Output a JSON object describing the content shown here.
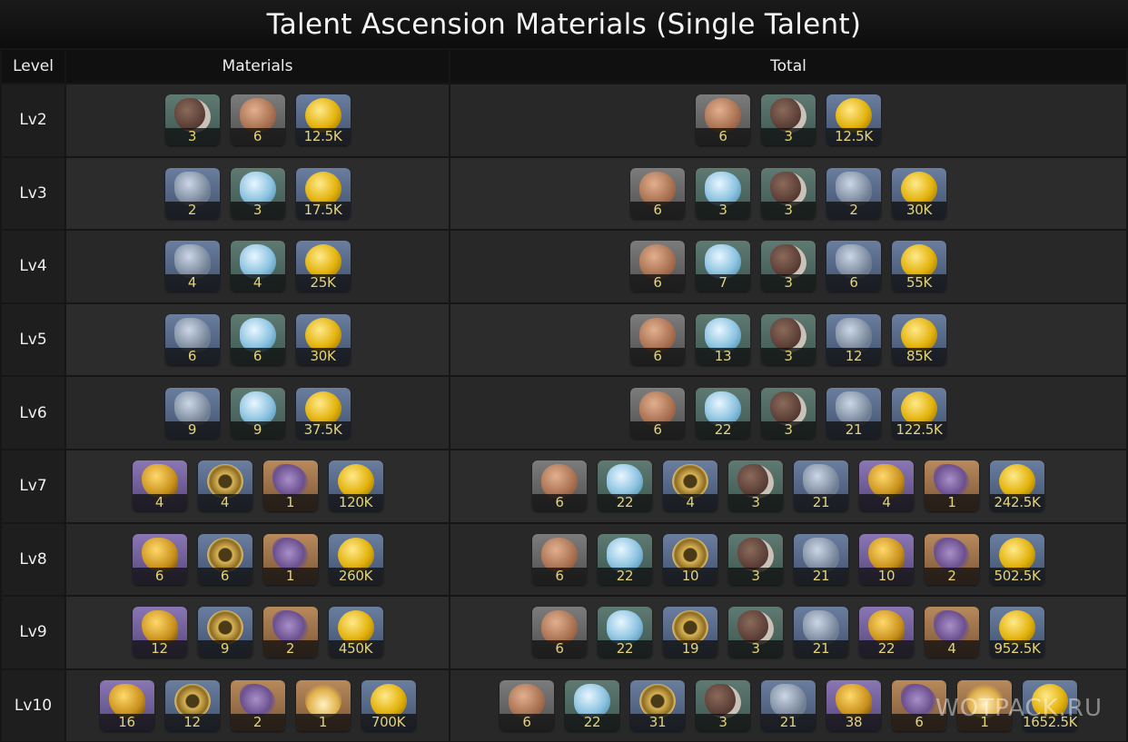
{
  "title": "Talent Ascension Materials (Single Talent)",
  "headers": {
    "level": "Level",
    "materials": "Materials",
    "total": "Total"
  },
  "watermark": "WOTPACK.RU",
  "rows": [
    {
      "level": "Lv2",
      "materials": [
        {
          "icon": "scroll",
          "bg": "green",
          "count": "3"
        },
        {
          "icon": "shell",
          "bg": "gray",
          "count": "6"
        },
        {
          "icon": "coin",
          "bg": "blue",
          "count": "12.5K"
        }
      ],
      "total": [
        {
          "icon": "shell",
          "bg": "gray",
          "count": "6"
        },
        {
          "icon": "scroll",
          "bg": "green",
          "count": "3"
        },
        {
          "icon": "coin",
          "bg": "blue",
          "count": "12.5K"
        }
      ]
    },
    {
      "level": "Lv3",
      "materials": [
        {
          "icon": "gear",
          "bg": "blue",
          "count": "2"
        },
        {
          "icon": "crystal",
          "bg": "green",
          "count": "3"
        },
        {
          "icon": "coin",
          "bg": "blue",
          "count": "17.5K"
        }
      ],
      "total": [
        {
          "icon": "shell",
          "bg": "gray",
          "count": "6"
        },
        {
          "icon": "crystal",
          "bg": "green",
          "count": "3"
        },
        {
          "icon": "scroll",
          "bg": "green",
          "count": "3"
        },
        {
          "icon": "gear",
          "bg": "blue",
          "count": "2"
        },
        {
          "icon": "coin",
          "bg": "blue",
          "count": "30K"
        }
      ]
    },
    {
      "level": "Lv4",
      "materials": [
        {
          "icon": "gear",
          "bg": "blue",
          "count": "4"
        },
        {
          "icon": "crystal",
          "bg": "green",
          "count": "4"
        },
        {
          "icon": "coin",
          "bg": "blue",
          "count": "25K"
        }
      ],
      "total": [
        {
          "icon": "shell",
          "bg": "gray",
          "count": "6"
        },
        {
          "icon": "crystal",
          "bg": "green",
          "count": "7"
        },
        {
          "icon": "scroll",
          "bg": "green",
          "count": "3"
        },
        {
          "icon": "gear",
          "bg": "blue",
          "count": "6"
        },
        {
          "icon": "coin",
          "bg": "blue",
          "count": "55K"
        }
      ]
    },
    {
      "level": "Lv5",
      "materials": [
        {
          "icon": "gear",
          "bg": "blue",
          "count": "6"
        },
        {
          "icon": "crystal",
          "bg": "green",
          "count": "6"
        },
        {
          "icon": "coin",
          "bg": "blue",
          "count": "30K"
        }
      ],
      "total": [
        {
          "icon": "shell",
          "bg": "gray",
          "count": "6"
        },
        {
          "icon": "crystal",
          "bg": "green",
          "count": "13"
        },
        {
          "icon": "scroll",
          "bg": "green",
          "count": "3"
        },
        {
          "icon": "gear",
          "bg": "blue",
          "count": "12"
        },
        {
          "icon": "coin",
          "bg": "blue",
          "count": "85K"
        }
      ]
    },
    {
      "level": "Lv6",
      "materials": [
        {
          "icon": "gear",
          "bg": "blue",
          "count": "9"
        },
        {
          "icon": "crystal",
          "bg": "green",
          "count": "9"
        },
        {
          "icon": "coin",
          "bg": "blue",
          "count": "37.5K"
        }
      ],
      "total": [
        {
          "icon": "shell",
          "bg": "gray",
          "count": "6"
        },
        {
          "icon": "crystal",
          "bg": "green",
          "count": "22"
        },
        {
          "icon": "scroll",
          "bg": "green",
          "count": "3"
        },
        {
          "icon": "gear",
          "bg": "blue",
          "count": "21"
        },
        {
          "icon": "coin",
          "bg": "blue",
          "count": "122.5K"
        }
      ]
    },
    {
      "level": "Lv7",
      "materials": [
        {
          "icon": "goblet",
          "bg": "purple",
          "count": "4"
        },
        {
          "icon": "ring",
          "bg": "blue",
          "count": "4"
        },
        {
          "icon": "feather",
          "bg": "orange",
          "count": "1"
        },
        {
          "icon": "coin",
          "bg": "blue",
          "count": "120K"
        }
      ],
      "total": [
        {
          "icon": "shell",
          "bg": "gray",
          "count": "6"
        },
        {
          "icon": "crystal",
          "bg": "green",
          "count": "22"
        },
        {
          "icon": "ring",
          "bg": "blue",
          "count": "4"
        },
        {
          "icon": "scroll",
          "bg": "green",
          "count": "3"
        },
        {
          "icon": "gear",
          "bg": "blue",
          "count": "21"
        },
        {
          "icon": "goblet",
          "bg": "purple",
          "count": "4"
        },
        {
          "icon": "feather",
          "bg": "orange",
          "count": "1"
        },
        {
          "icon": "coin",
          "bg": "blue",
          "count": "242.5K"
        }
      ]
    },
    {
      "level": "Lv8",
      "materials": [
        {
          "icon": "goblet",
          "bg": "purple",
          "count": "6"
        },
        {
          "icon": "ring",
          "bg": "blue",
          "count": "6"
        },
        {
          "icon": "feather",
          "bg": "orange",
          "count": "1"
        },
        {
          "icon": "coin",
          "bg": "blue",
          "count": "260K"
        }
      ],
      "total": [
        {
          "icon": "shell",
          "bg": "gray",
          "count": "6"
        },
        {
          "icon": "crystal",
          "bg": "green",
          "count": "22"
        },
        {
          "icon": "ring",
          "bg": "blue",
          "count": "10"
        },
        {
          "icon": "scroll",
          "bg": "green",
          "count": "3"
        },
        {
          "icon": "gear",
          "bg": "blue",
          "count": "21"
        },
        {
          "icon": "goblet",
          "bg": "purple",
          "count": "10"
        },
        {
          "icon": "feather",
          "bg": "orange",
          "count": "2"
        },
        {
          "icon": "coin",
          "bg": "blue",
          "count": "502.5K"
        }
      ]
    },
    {
      "level": "Lv9",
      "materials": [
        {
          "icon": "goblet",
          "bg": "purple",
          "count": "12"
        },
        {
          "icon": "ring",
          "bg": "blue",
          "count": "9"
        },
        {
          "icon": "feather",
          "bg": "orange",
          "count": "2"
        },
        {
          "icon": "coin",
          "bg": "blue",
          "count": "450K"
        }
      ],
      "total": [
        {
          "icon": "shell",
          "bg": "gray",
          "count": "6"
        },
        {
          "icon": "crystal",
          "bg": "green",
          "count": "22"
        },
        {
          "icon": "ring",
          "bg": "blue",
          "count": "19"
        },
        {
          "icon": "scroll",
          "bg": "green",
          "count": "3"
        },
        {
          "icon": "gear",
          "bg": "blue",
          "count": "21"
        },
        {
          "icon": "goblet",
          "bg": "purple",
          "count": "22"
        },
        {
          "icon": "feather",
          "bg": "orange",
          "count": "4"
        },
        {
          "icon": "coin",
          "bg": "blue",
          "count": "952.5K"
        }
      ]
    },
    {
      "level": "Lv10",
      "materials": [
        {
          "icon": "goblet",
          "bg": "purple",
          "count": "16"
        },
        {
          "icon": "ring",
          "bg": "blue",
          "count": "12"
        },
        {
          "icon": "feather",
          "bg": "orange",
          "count": "2"
        },
        {
          "icon": "crown",
          "bg": "orange",
          "count": "1"
        },
        {
          "icon": "coin",
          "bg": "blue",
          "count": "700K"
        }
      ],
      "total": [
        {
          "icon": "shell",
          "bg": "gray",
          "count": "6"
        },
        {
          "icon": "crystal",
          "bg": "green",
          "count": "22"
        },
        {
          "icon": "ring",
          "bg": "blue",
          "count": "31"
        },
        {
          "icon": "scroll",
          "bg": "green",
          "count": "3"
        },
        {
          "icon": "gear",
          "bg": "blue",
          "count": "21"
        },
        {
          "icon": "goblet",
          "bg": "purple",
          "count": "38"
        },
        {
          "icon": "feather",
          "bg": "orange",
          "count": "6"
        },
        {
          "icon": "crown",
          "bg": "orange",
          "count": "1"
        },
        {
          "icon": "coin",
          "bg": "blue",
          "count": "1652.5K"
        }
      ]
    }
  ]
}
